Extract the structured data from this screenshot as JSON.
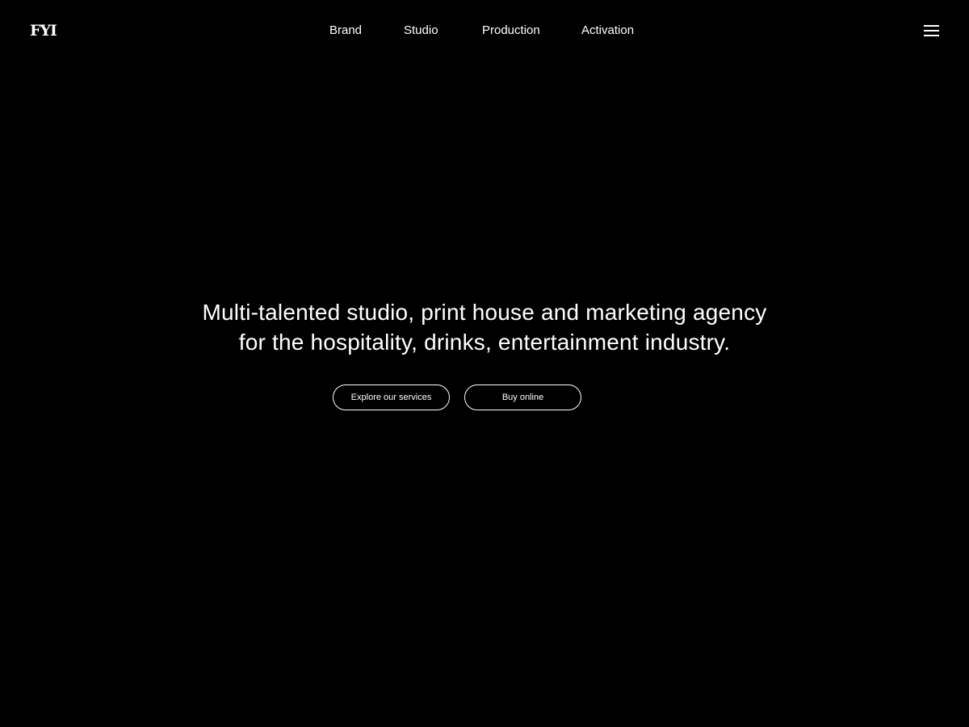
{
  "brand": {
    "logo_text": "FYI"
  },
  "nav": {
    "items": [
      {
        "label": "Brand"
      },
      {
        "label": "Studio"
      },
      {
        "label": "Production"
      },
      {
        "label": "Activation"
      }
    ],
    "menu_icon": "hamburger-menu-icon"
  },
  "hero": {
    "headline_line1": "Multi-talented studio, print house and marketing agency",
    "headline_line2": "for the hospitality, drinks, entertainment industry.",
    "buttons": {
      "explore_label": "Explore our services",
      "buy_label": "Buy online"
    }
  },
  "colors": {
    "background": "#000000",
    "foreground": "#ffffff"
  }
}
